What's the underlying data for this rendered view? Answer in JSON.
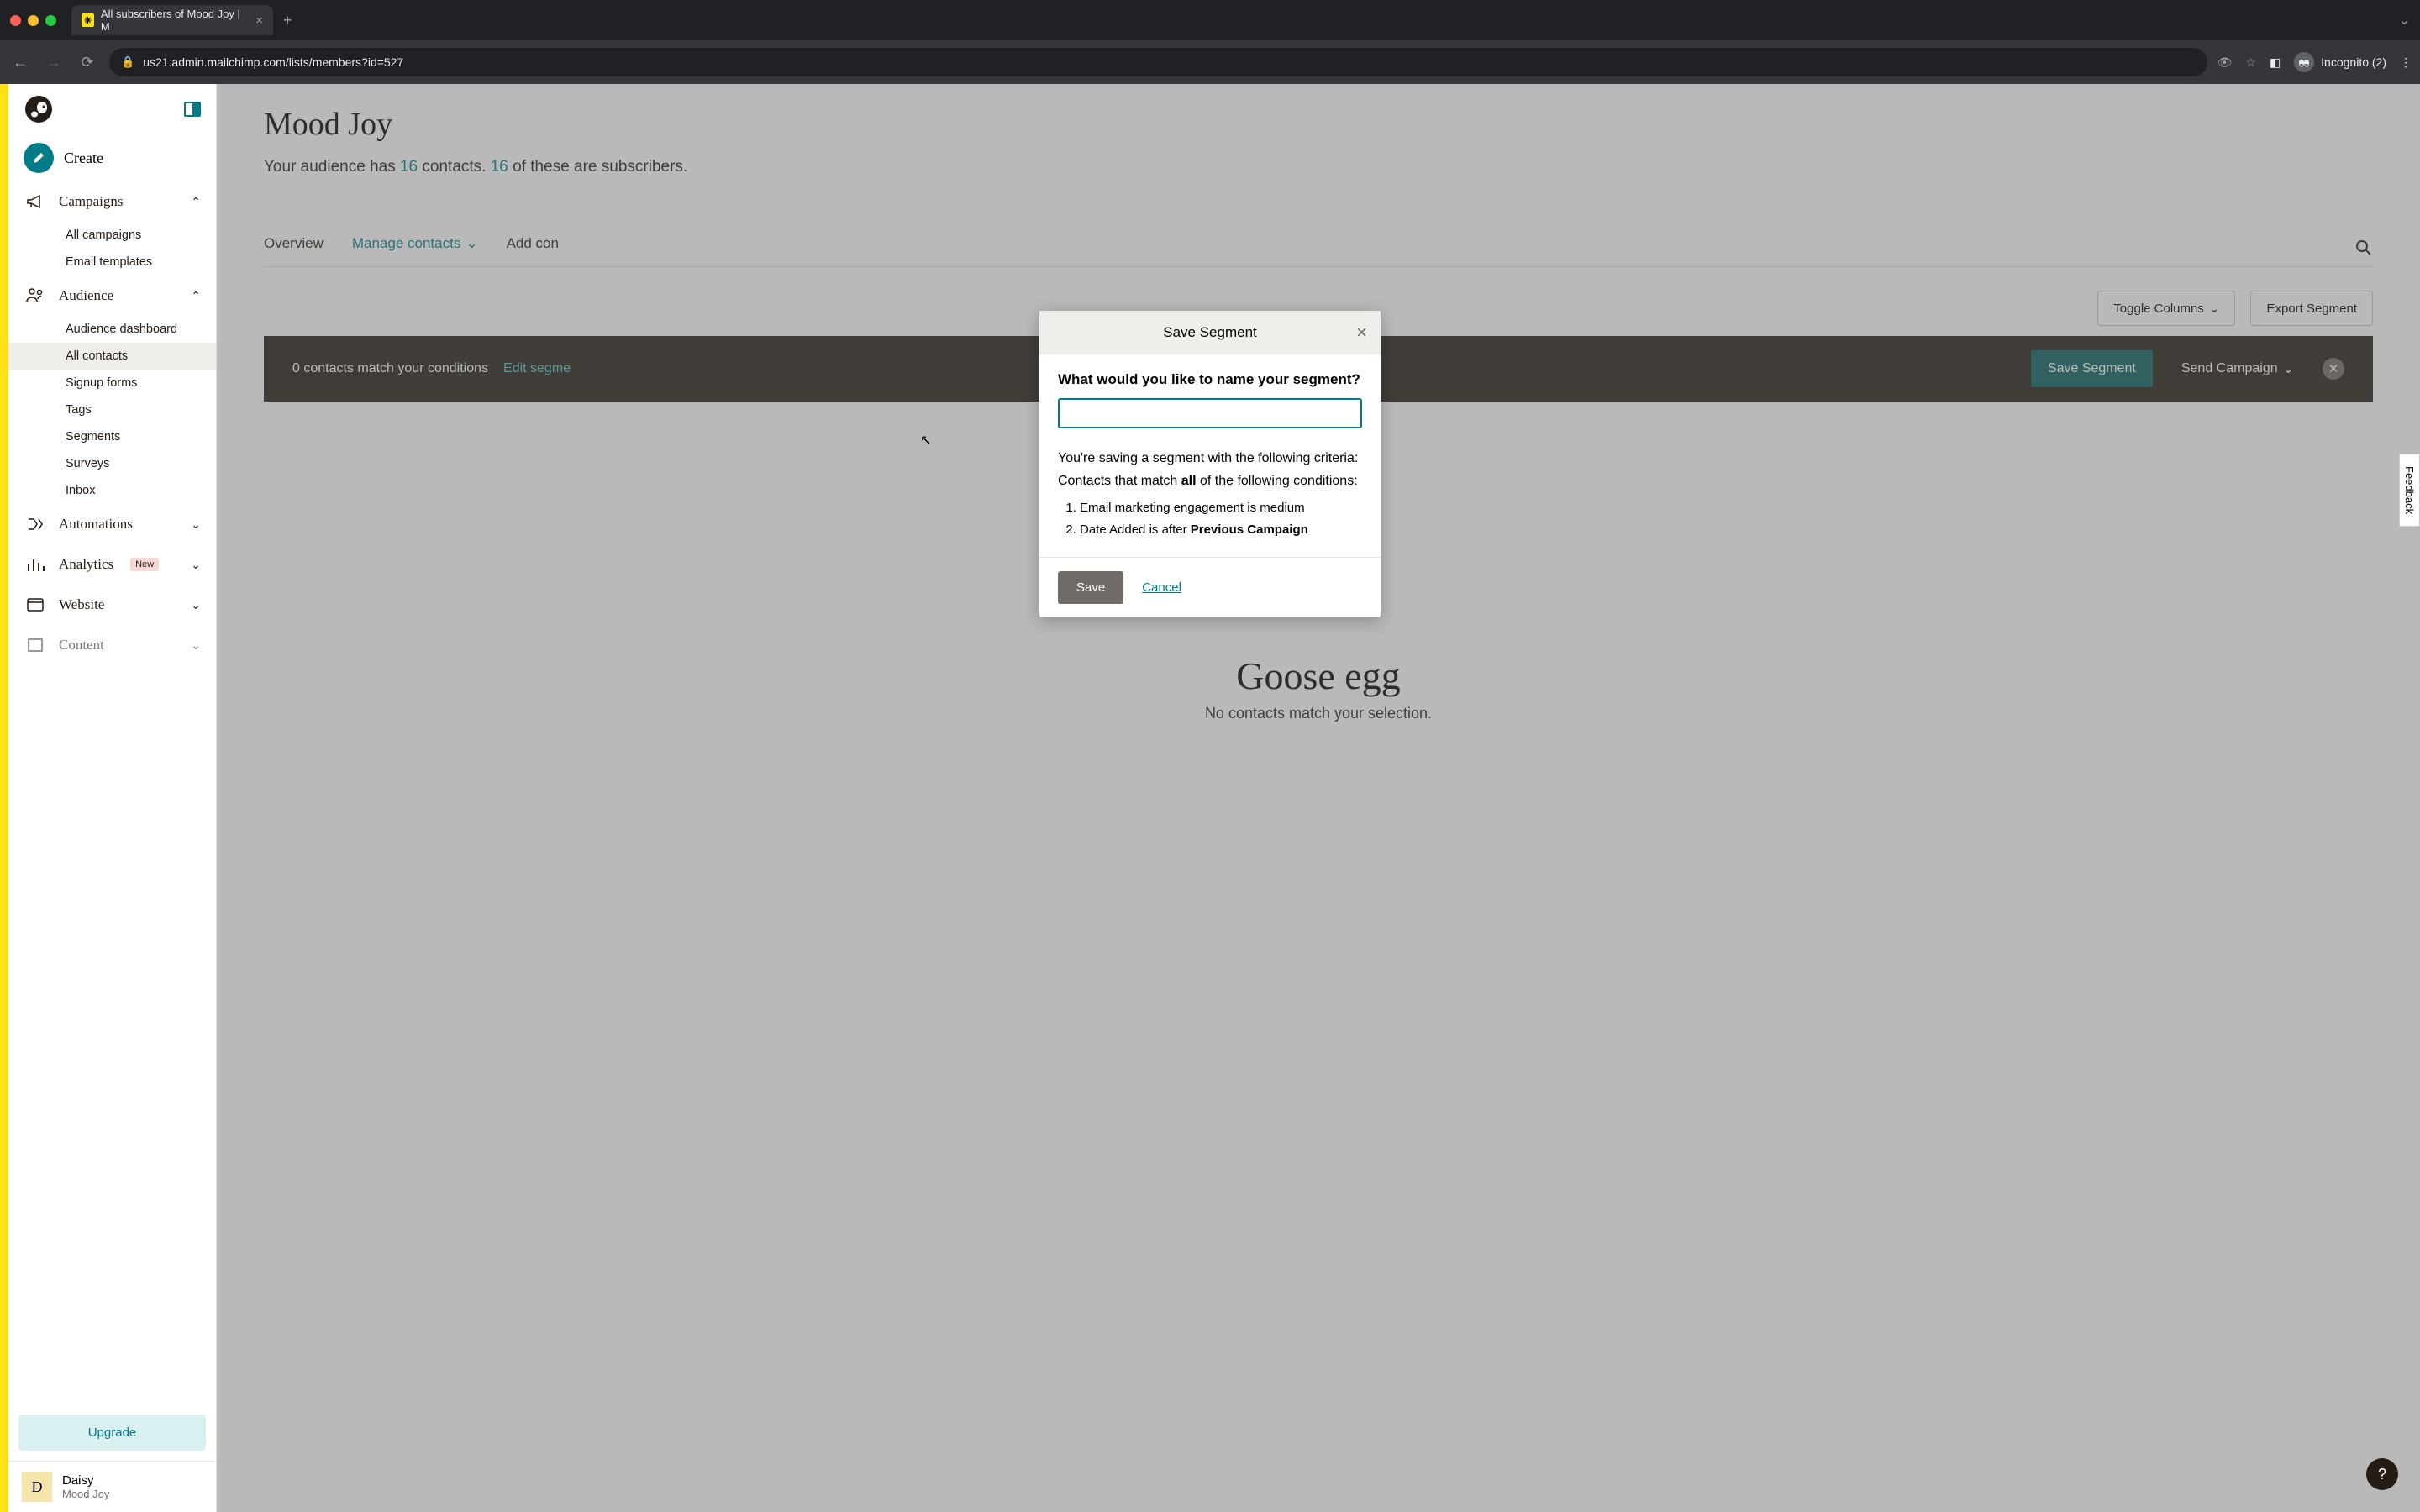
{
  "browser": {
    "tab_title": "All subscribers of Mood Joy | M",
    "url": "us21.admin.mailchimp.com/lists/members?id=527",
    "incognito_label": "Incognito (2)"
  },
  "sidebar": {
    "create": "Create",
    "items": [
      {
        "label": "Campaigns",
        "expanded": true
      },
      {
        "label": "Audience",
        "expanded": true
      },
      {
        "label": "Automations",
        "expanded": false
      },
      {
        "label": "Analytics",
        "expanded": false,
        "badge": "New"
      },
      {
        "label": "Website",
        "expanded": false
      },
      {
        "label": "Content",
        "expanded": false
      }
    ],
    "campaigns_sub": [
      "All campaigns",
      "Email templates"
    ],
    "audience_sub": [
      "Audience dashboard",
      "All contacts",
      "Signup forms",
      "Tags",
      "Segments",
      "Surveys",
      "Inbox"
    ],
    "audience_active": "All contacts",
    "upgrade": "Upgrade",
    "user": {
      "initial": "D",
      "name": "Daisy",
      "org": "Mood Joy"
    }
  },
  "page": {
    "title": "Mood Joy",
    "subtitle_pre": "Your audience has ",
    "count1": "16",
    "subtitle_mid": " contacts. ",
    "count2": "16",
    "subtitle_post": " of these are subscribers.",
    "tabs": {
      "overview": "Overview",
      "manage": "Manage contacts",
      "add": "Add con"
    },
    "toggle_columns": "Toggle Columns",
    "export_segment": "Export Segment",
    "darkbar": {
      "match_text": "0 contacts match your conditions",
      "edit": "Edit segme",
      "save": "Save Segment",
      "send": "Send Campaign"
    },
    "empty": {
      "title": "Goose egg",
      "sub": "No contacts match your selection."
    }
  },
  "modal": {
    "title": "Save Segment",
    "question": "What would you like to name your segment?",
    "input_value": "",
    "criteria_intro": "You're saving a segment with the following criteria:",
    "criteria_match_pre": "Contacts that match ",
    "criteria_match_bold": "all",
    "criteria_match_post": " of the following conditions:",
    "conditions": [
      {
        "text": "Email marketing engagement is medium",
        "bold": ""
      },
      {
        "text": "Date Added is after ",
        "bold": "Previous Campaign"
      }
    ],
    "save": "Save",
    "cancel": "Cancel"
  },
  "misc": {
    "feedback": "Feedback",
    "help": "?"
  }
}
